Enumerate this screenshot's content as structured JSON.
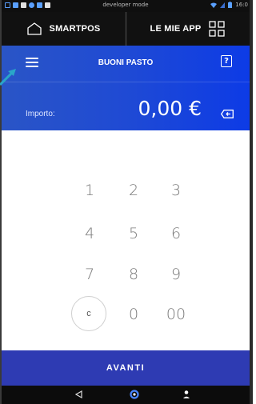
{
  "status_bar": {
    "center_text": "developer mode",
    "time": "16:0"
  },
  "top_bar": {
    "home_label": "SMARTPOS",
    "apps_label": "LE MIE APP"
  },
  "header": {
    "title": "BUONI PASTO",
    "help_glyph": "?"
  },
  "amount": {
    "label": "Importo:",
    "value": "0,00 €"
  },
  "keypad": {
    "keys": [
      "1",
      "2",
      "3",
      "4",
      "5",
      "6",
      "7",
      "8",
      "9",
      "c",
      "0",
      "00"
    ]
  },
  "action": {
    "label": "AVANTI"
  },
  "colors": {
    "blue_header": "#1f4ad4",
    "action_button": "#2e3bb3",
    "top_bar": "#111111",
    "key_text": "#7a7a7a"
  },
  "icons": {
    "home": "house-outline-icon",
    "apps": "grid-four-squares-icon",
    "menu": "hamburger-menu-icon",
    "help": "help-question-icon",
    "backspace": "backspace-icon",
    "nav_back": "triangle-back-icon",
    "nav_home": "circle-home-icon",
    "nav_user": "person-icon"
  }
}
